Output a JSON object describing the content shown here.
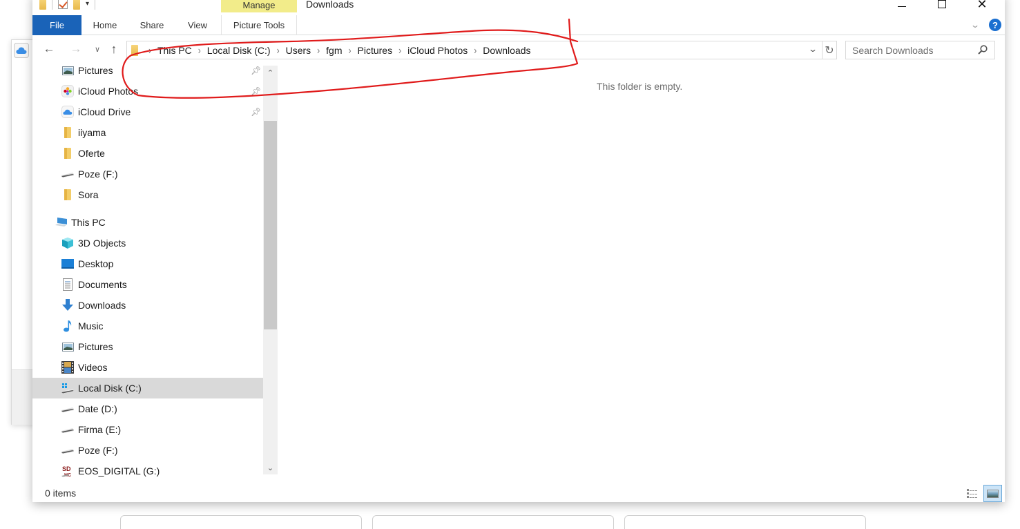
{
  "window": {
    "title": "Downloads",
    "contextual_tab_group": "Manage",
    "controls": {
      "minimize": "minimize",
      "maximize": "maximize",
      "close": "✕"
    }
  },
  "ribbon": {
    "tabs": [
      {
        "label": "File",
        "active": true
      },
      {
        "label": "Home"
      },
      {
        "label": "Share"
      },
      {
        "label": "View"
      },
      {
        "label": "Picture Tools"
      }
    ],
    "help_label": "?"
  },
  "navigation": {
    "back": "←",
    "forward": "→",
    "recent": "⌄",
    "up": "↑",
    "breadcrumb": [
      "This PC",
      "Local Disk (C:)",
      "Users",
      "fgm",
      "Pictures",
      "iCloud Photos",
      "Downloads"
    ],
    "refresh": "↻",
    "search_placeholder": "Search Downloads"
  },
  "nav_pane": {
    "quick_access": [
      {
        "label": "Pictures",
        "icon": "pictures-icon",
        "pinned": true
      },
      {
        "label": "iCloud Photos",
        "icon": "icloud-photos-icon",
        "pinned": true
      },
      {
        "label": "iCloud Drive",
        "icon": "icloud-drive-icon",
        "pinned": true
      },
      {
        "label": "iiyama",
        "icon": "folder-icon"
      },
      {
        "label": "Oferte",
        "icon": "folder-icon"
      },
      {
        "label": "Poze (F:)",
        "icon": "drive-icon"
      },
      {
        "label": "Sora",
        "icon": "folder-icon"
      }
    ],
    "this_pc": {
      "label": "This PC",
      "items": [
        {
          "label": "3D Objects",
          "icon": "3d-objects-icon"
        },
        {
          "label": "Desktop",
          "icon": "desktop-icon"
        },
        {
          "label": "Documents",
          "icon": "documents-icon"
        },
        {
          "label": "Downloads",
          "icon": "downloads-icon"
        },
        {
          "label": "Music",
          "icon": "music-icon"
        },
        {
          "label": "Pictures",
          "icon": "pictures-icon"
        },
        {
          "label": "Videos",
          "icon": "videos-icon"
        },
        {
          "label": "Local Disk (C:)",
          "icon": "system-drive-icon",
          "selected": true
        },
        {
          "label": "Date (D:)",
          "icon": "drive-icon"
        },
        {
          "label": "Firma (E:)",
          "icon": "drive-icon"
        },
        {
          "label": "Poze (F:)",
          "icon": "drive-icon"
        },
        {
          "label": "EOS_DIGITAL (G:)",
          "icon": "sd-card-icon"
        }
      ]
    }
  },
  "content": {
    "empty_message": "This folder is empty."
  },
  "status_bar": {
    "item_count": "0 items",
    "views": [
      "details-view",
      "large-icons-view"
    ],
    "active_view": "large-icons-view"
  },
  "colors": {
    "file_tab": "#1a63b8",
    "manage_tab": "#f2ec8a",
    "selection": "#d9d9d9",
    "annotation": "#e01b1b",
    "help": "#1a6fd0"
  }
}
